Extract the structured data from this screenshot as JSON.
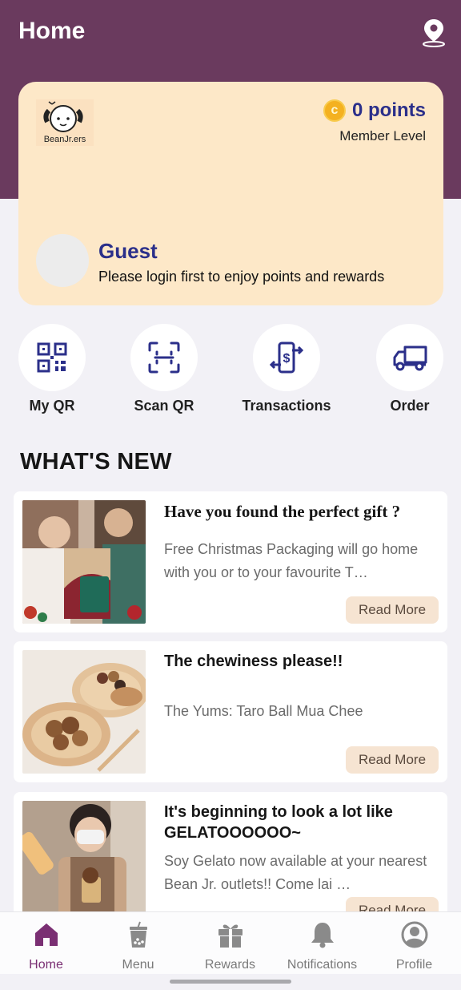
{
  "header": {
    "title": "Home"
  },
  "member_card": {
    "logo_text": "BeanJr.ers",
    "points": "0 points",
    "coin_symbol": "c",
    "member_level_label": "Member Level",
    "guest_name": "Guest",
    "guest_message": "Please login first to enjoy points and rewards"
  },
  "quick_actions": [
    {
      "label": "My QR",
      "icon": "qr-code-icon"
    },
    {
      "label": "Scan QR",
      "icon": "scan-icon"
    },
    {
      "label": "Transactions",
      "icon": "transactions-icon"
    },
    {
      "label": "Order",
      "icon": "truck-icon"
    }
  ],
  "whats_new": {
    "title": "WHAT'S NEW",
    "items": [
      {
        "title": "Have you found the perfect gift ?",
        "description": "Free Christmas Packaging will go home with you or to your favourite T…",
        "button": "Read More"
      },
      {
        "title": "The chewiness please!!",
        "description": "The Yums: Taro Ball Mua Chee",
        "button": "Read More"
      },
      {
        "title": "It's beginning to look a lot like GELATOOOOOO~",
        "description": "Soy Gelato now available at your nearest Bean Jr. outlets!! Come lai …",
        "button": "Read More"
      }
    ]
  },
  "tabbar": [
    {
      "label": "Home",
      "active": true
    },
    {
      "label": "Menu",
      "active": false
    },
    {
      "label": "Rewards",
      "active": false
    },
    {
      "label": "Notifications",
      "active": false
    },
    {
      "label": "Profile",
      "active": false
    }
  ],
  "colors": {
    "header": "#6a3a5e",
    "card": "#fde8c8",
    "accent_blue": "#2b2f8a",
    "active_tab": "#7a2f73"
  }
}
